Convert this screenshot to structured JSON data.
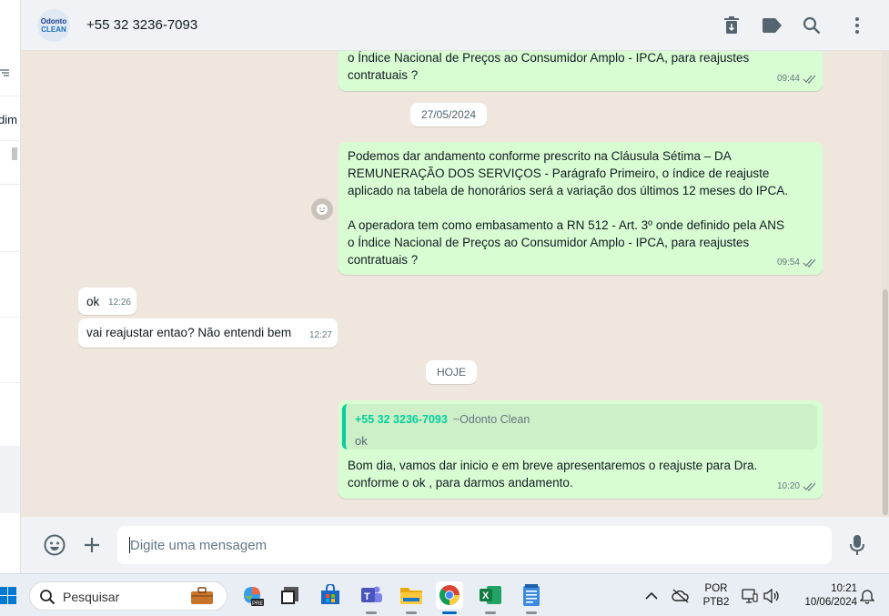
{
  "left_panel": {
    "cut_text": "dim"
  },
  "header": {
    "avatar": {
      "line1": "Odonto",
      "line2": "CLEAN"
    },
    "title": "+55 32 3236-7093",
    "icons": [
      "delete-icon",
      "label-icon",
      "search-icon",
      "menu-icon"
    ]
  },
  "chat": {
    "messages": [
      {
        "dir": "out",
        "text": "o Índice Nacional de Preços ao Consumidor Amplo - IPCA, para reajustes\ncontratuais ?",
        "time": "09:44"
      },
      {
        "kind": "date",
        "text": "27/05/2024"
      },
      {
        "dir": "out",
        "text": "Podemos dar andamento conforme prescrito na Cláusula Sétima – DA\nREMUNERAÇÃO DOS SERVIÇOS - Parágrafo Primeiro, o índice de reajuste\naplicado na tabela de honorários será a variação dos últimos 12 meses do IPCA.\n\nA operadora tem como embasamento a RN 512 - Art. 3º onde definido pela ANS\no Índice Nacional de Preços ao Consumidor Amplo - IPCA, para reajustes\ncontratuais ?",
        "time": "09:54"
      },
      {
        "dir": "in",
        "text": "ok",
        "time": "12:26"
      },
      {
        "dir": "in",
        "text": "vai reajustar entao? Não entendi bem",
        "time": "12:27"
      },
      {
        "kind": "date",
        "text": "HOJE"
      },
      {
        "dir": "out",
        "quote": {
          "name": "+55 32 3236-7093",
          "sub": "~Odonto Clean",
          "text": "ok"
        },
        "text": "Bom dia, vamos dar inicio e em breve apresentaremos o reajuste para Dra.\nconforme o ok , para darmos andamento.",
        "time": "10:20"
      }
    ]
  },
  "composer": {
    "placeholder": "Digite uma mensagem"
  },
  "taskbar": {
    "search_label": "Pesquisar",
    "apps": [
      "briefcase-icon",
      "copilot-pre-icon",
      "task-view-icon",
      "store-icon",
      "teams-icon",
      "file-explorer-icon",
      "chrome-icon",
      "excel-icon",
      "notepad-icon"
    ],
    "tray": {
      "lang": "POR",
      "layout": "PTB2",
      "time": "10:21",
      "date": "10/06/2024"
    }
  },
  "colors": {
    "outgoing_bubble": "#d9fdd3",
    "incoming_bubble": "#ffffff",
    "chat_bg": "#efe7de",
    "accent": "#06cf9c"
  }
}
